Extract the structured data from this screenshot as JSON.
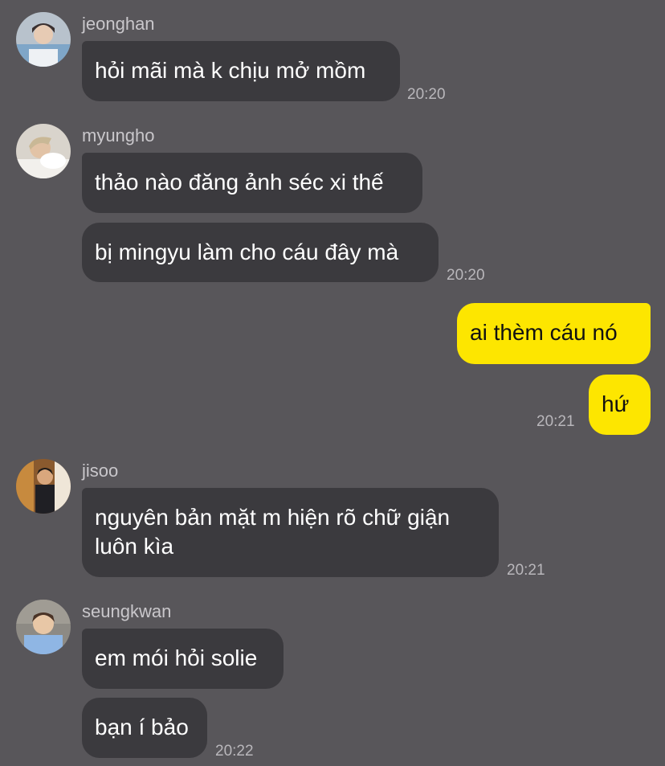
{
  "colors": {
    "background": "#58565a",
    "incoming_bubble": "#3b3a3e",
    "outgoing_bubble": "#fde600",
    "name_text": "#c9c7cb",
    "time_text": "#b9b7bb"
  },
  "messages": [
    {
      "sender": "jeonghan",
      "avatar_icon": "jeonghan-avatar",
      "bubbles": [
        "hỏi mãi mà k chịu mở mồm"
      ],
      "time": "20:20"
    },
    {
      "sender": "myungho",
      "avatar_icon": "myungho-avatar",
      "bubbles": [
        "thảo nào đăng ảnh séc xi thế",
        "bị mingyu làm cho cáu đây mà"
      ],
      "time": "20:20"
    },
    {
      "sender": "me",
      "bubbles": [
        "ai thèm cáu nó",
        "hứ"
      ],
      "time": "20:21"
    },
    {
      "sender": "jisoo",
      "avatar_icon": "jisoo-avatar",
      "bubbles": [
        "nguyên bản mặt m hiện rõ chữ giận luôn kìa"
      ],
      "time": "20:21"
    },
    {
      "sender": "seungkwan",
      "avatar_icon": "seungkwan-avatar",
      "bubbles": [
        "em mói hỏi solie",
        "bạn í bảo"
      ],
      "time": "20:22"
    }
  ]
}
